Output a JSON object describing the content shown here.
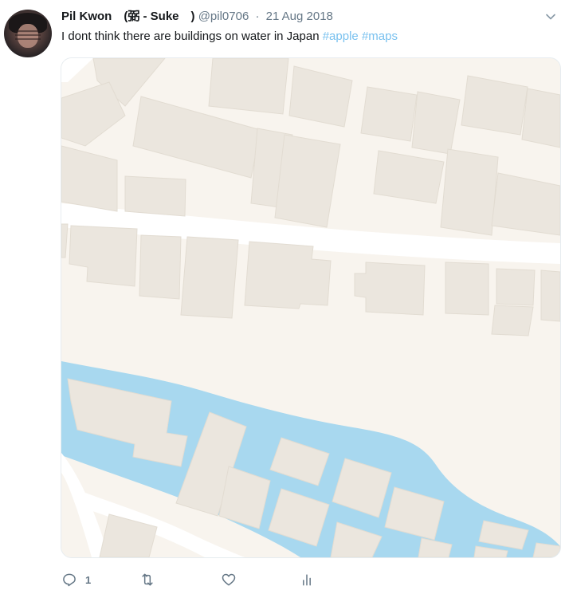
{
  "tweet": {
    "author_name": "Pil Kwon　(弼 - Suke　)",
    "handle": "@pil0706",
    "separator": "·",
    "date": "21 Aug 2018",
    "text": "I dont think there are buildings on water in Japan",
    "hashtags": [
      "#apple",
      "#maps"
    ]
  },
  "actions": {
    "reply_count": "1",
    "retweet_count": "",
    "like_count": ""
  },
  "icons": {
    "chevron": "chevron-down-icon",
    "reply": "reply-icon",
    "retweet": "retweet-icon",
    "like": "heart-icon",
    "analytics": "analytics-icon"
  },
  "colors": {
    "hashtag": "#79c1ef",
    "secondary_text": "#657786",
    "map_land": "#f8f4ee",
    "map_building": "#ebe6de",
    "map_water": "#a8d8ef",
    "map_road": "#ffffff"
  }
}
